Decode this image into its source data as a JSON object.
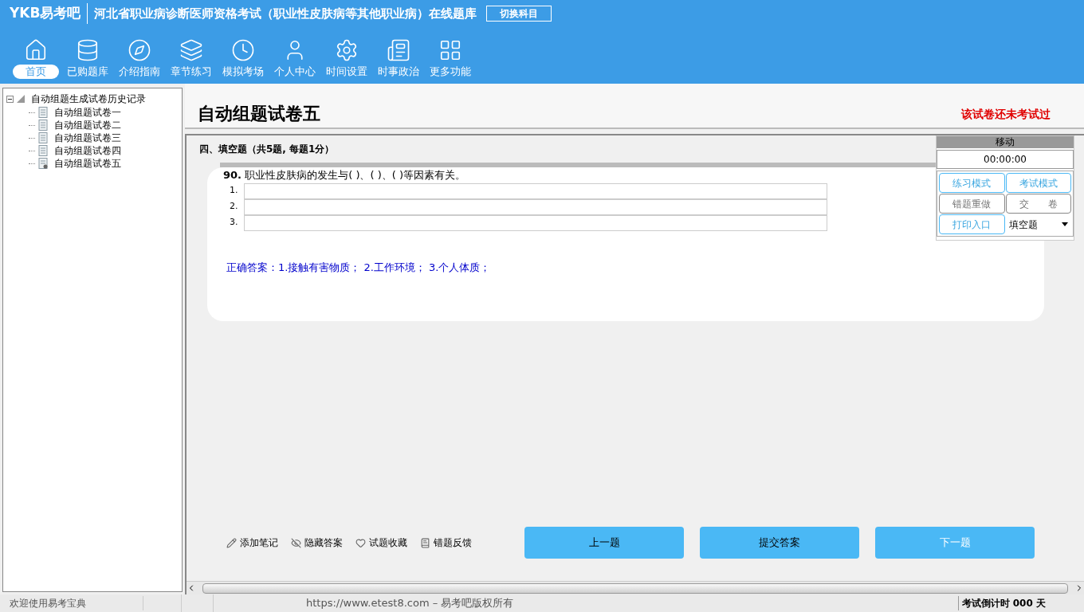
{
  "header": {
    "logo": "YKB易考吧",
    "title": "河北省职业病诊断医师资格考试（职业性皮肤病等其他职业病）在线题库",
    "switch_button": "切换科目"
  },
  "nav": [
    {
      "label": "首页",
      "selected": true
    },
    {
      "label": "已购题库",
      "selected": false
    },
    {
      "label": "介绍指南",
      "selected": false
    },
    {
      "label": "章节练习",
      "selected": false
    },
    {
      "label": "模拟考场",
      "selected": false
    },
    {
      "label": "个人中心",
      "selected": false
    },
    {
      "label": "时间设置",
      "selected": false
    },
    {
      "label": "时事政治",
      "selected": false
    },
    {
      "label": "更多功能",
      "selected": false
    }
  ],
  "tree": {
    "label": "自动组题生成试卷历史记录",
    "expanded": true,
    "children": [
      {
        "label": "自动组题试卷一",
        "selected": false
      },
      {
        "label": "自动组题试卷二",
        "selected": false
      },
      {
        "label": "自动组题试卷三",
        "selected": false
      },
      {
        "label": "自动组题试卷四",
        "selected": false
      },
      {
        "label": "自动组题试卷五",
        "selected": true
      }
    ]
  },
  "paper": {
    "title": "自动组题试卷五",
    "status": "该试卷还未考试过"
  },
  "section": "四、填空题（共5题, 每题1分）",
  "question": {
    "number": "90.",
    "text": "职业性皮肤病的发生与( )、( )、( )等因素有关。",
    "blanks": [
      "1.",
      "2.",
      "3."
    ],
    "answer": "正确答案：1.接触有害物质； 2.工作环境； 3.个人体质；"
  },
  "tools": [
    {
      "label": "添加笔记"
    },
    {
      "label": "隐藏答案"
    },
    {
      "label": "试题收藏"
    },
    {
      "label": "错题反馈"
    }
  ],
  "nav_buttons": [
    {
      "label": "上一题",
      "disabled": false
    },
    {
      "label": "提交答案",
      "disabled": false
    },
    {
      "label": "下一题",
      "disabled": true
    }
  ],
  "side_panel": {
    "title": "移动",
    "timer": "00:00:00",
    "buttons": [
      {
        "label": "练习模式",
        "disabled": false
      },
      {
        "label": "考试模式",
        "disabled": false
      },
      {
        "label": "错题重做",
        "disabled": true
      },
      {
        "label": "交　　卷",
        "disabled": true
      },
      {
        "label": "打印入口",
        "disabled": false
      }
    ],
    "select": "填空题"
  },
  "status_bar": {
    "welcome": "欢迎使用易考宝典",
    "copyright": "https://www.etest8.com – 易考吧版权所有",
    "countdown": "考试倒计时 000 天"
  }
}
